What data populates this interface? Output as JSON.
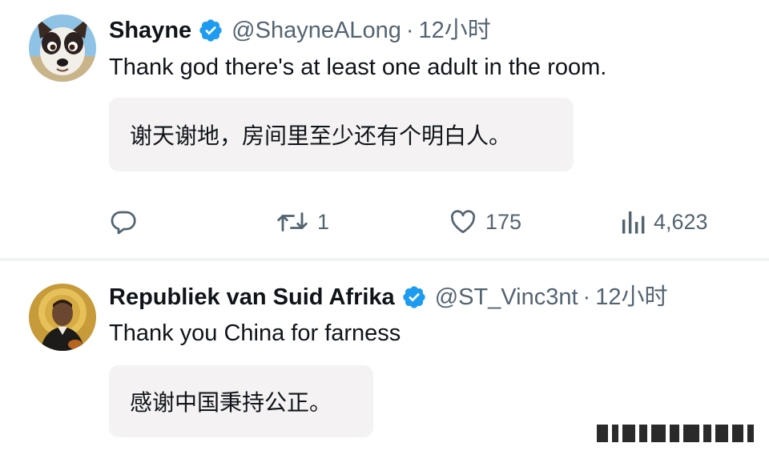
{
  "tweets": [
    {
      "display_name": "Shayne",
      "handle": "@ShayneALong",
      "separator": "·",
      "time": "12小时",
      "text": "Thank god there's at least one adult in the room.",
      "translation": "谢天谢地，房间里至少还有个明白人。",
      "avatar": "dog-avatar",
      "verified": true,
      "actions": {
        "reply": {
          "icon": "reply-icon",
          "count": ""
        },
        "retweet": {
          "icon": "retweet-icon",
          "count": "1"
        },
        "like": {
          "icon": "heart-icon",
          "count": "175"
        },
        "views": {
          "icon": "views-icon",
          "count": "4,623"
        }
      }
    },
    {
      "display_name": "Republiek van Suid Afrika",
      "handle": "@ST_Vinc3nt",
      "separator": "·",
      "time": "12小时",
      "text": "Thank you China for farness",
      "translation": "感谢中国秉持公正。",
      "avatar": "saint-portrait-avatar",
      "verified": true
    }
  ],
  "colors": {
    "text": "#0f1419",
    "secondary": "#536471",
    "verified": "#1d9bf0",
    "translation_bg": "#f4f2f2",
    "divider": "#eff3f4"
  }
}
